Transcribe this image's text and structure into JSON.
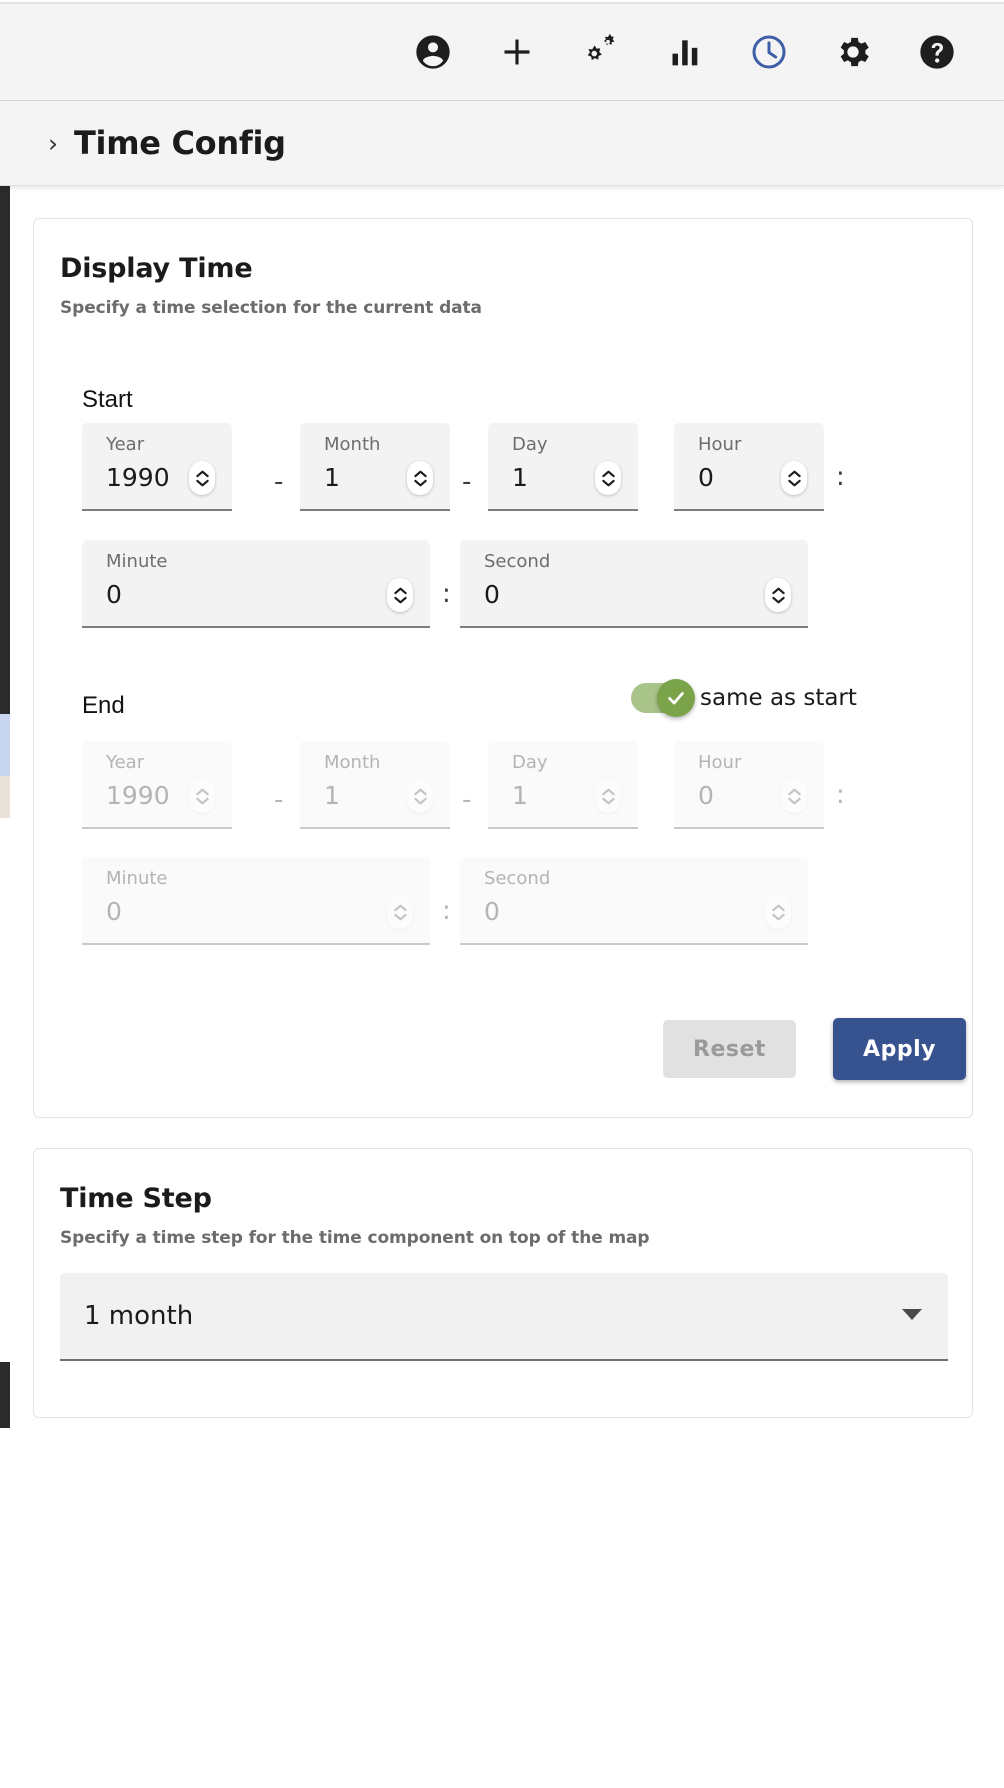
{
  "toolbar": {
    "items": [
      {
        "name": "account-icon",
        "label": "Account",
        "active": false
      },
      {
        "name": "plus-icon",
        "label": "Add",
        "active": false
      },
      {
        "name": "gears-icon",
        "label": "Processing",
        "active": false
      },
      {
        "name": "bar-chart-icon",
        "label": "Statistics",
        "active": false
      },
      {
        "name": "clock-icon",
        "label": "Time Config",
        "active": true
      },
      {
        "name": "gear-icon",
        "label": "Settings",
        "active": false
      },
      {
        "name": "help-icon",
        "label": "Help",
        "active": false
      }
    ],
    "active_color": "#3c5fa8",
    "icon_color": "#1e1e1e"
  },
  "header": {
    "chevron": "›",
    "title": "Time Config"
  },
  "display_time": {
    "title": "Display Time",
    "subtitle": "Specify a time selection for the current data",
    "start_label": "Start",
    "end_label": "End",
    "start": {
      "year": {
        "label": "Year",
        "value": "1990"
      },
      "month": {
        "label": "Month",
        "value": "1"
      },
      "day": {
        "label": "Day",
        "value": "1"
      },
      "hour": {
        "label": "Hour",
        "value": "0"
      },
      "minute": {
        "label": "Minute",
        "value": "0"
      },
      "second": {
        "label": "Second",
        "value": "0"
      }
    },
    "end": {
      "year": {
        "label": "Year",
        "value": "1990"
      },
      "month": {
        "label": "Month",
        "value": "1"
      },
      "day": {
        "label": "Day",
        "value": "1"
      },
      "hour": {
        "label": "Hour",
        "value": "0"
      },
      "minute": {
        "label": "Minute",
        "value": "0"
      },
      "second": {
        "label": "Second",
        "value": "0"
      }
    },
    "separators": {
      "date": "-",
      "time": ":"
    },
    "same_as_start": {
      "label": "same as start",
      "checked": true,
      "track_color": "#a9c489",
      "thumb_color": "#7aa34a"
    },
    "buttons": {
      "reset": {
        "label": "Reset",
        "enabled": false,
        "color": "#e1e1e1",
        "text_color": "#9a9a9a"
      },
      "apply": {
        "label": "Apply",
        "enabled": true,
        "color": "#36528f",
        "text_color": "#ffffff"
      }
    }
  },
  "time_step": {
    "title": "Time Step",
    "subtitle": "Specify a time step for the time component on top of the map",
    "select": {
      "value": "1 month",
      "caret": "chevron-down-icon"
    }
  }
}
